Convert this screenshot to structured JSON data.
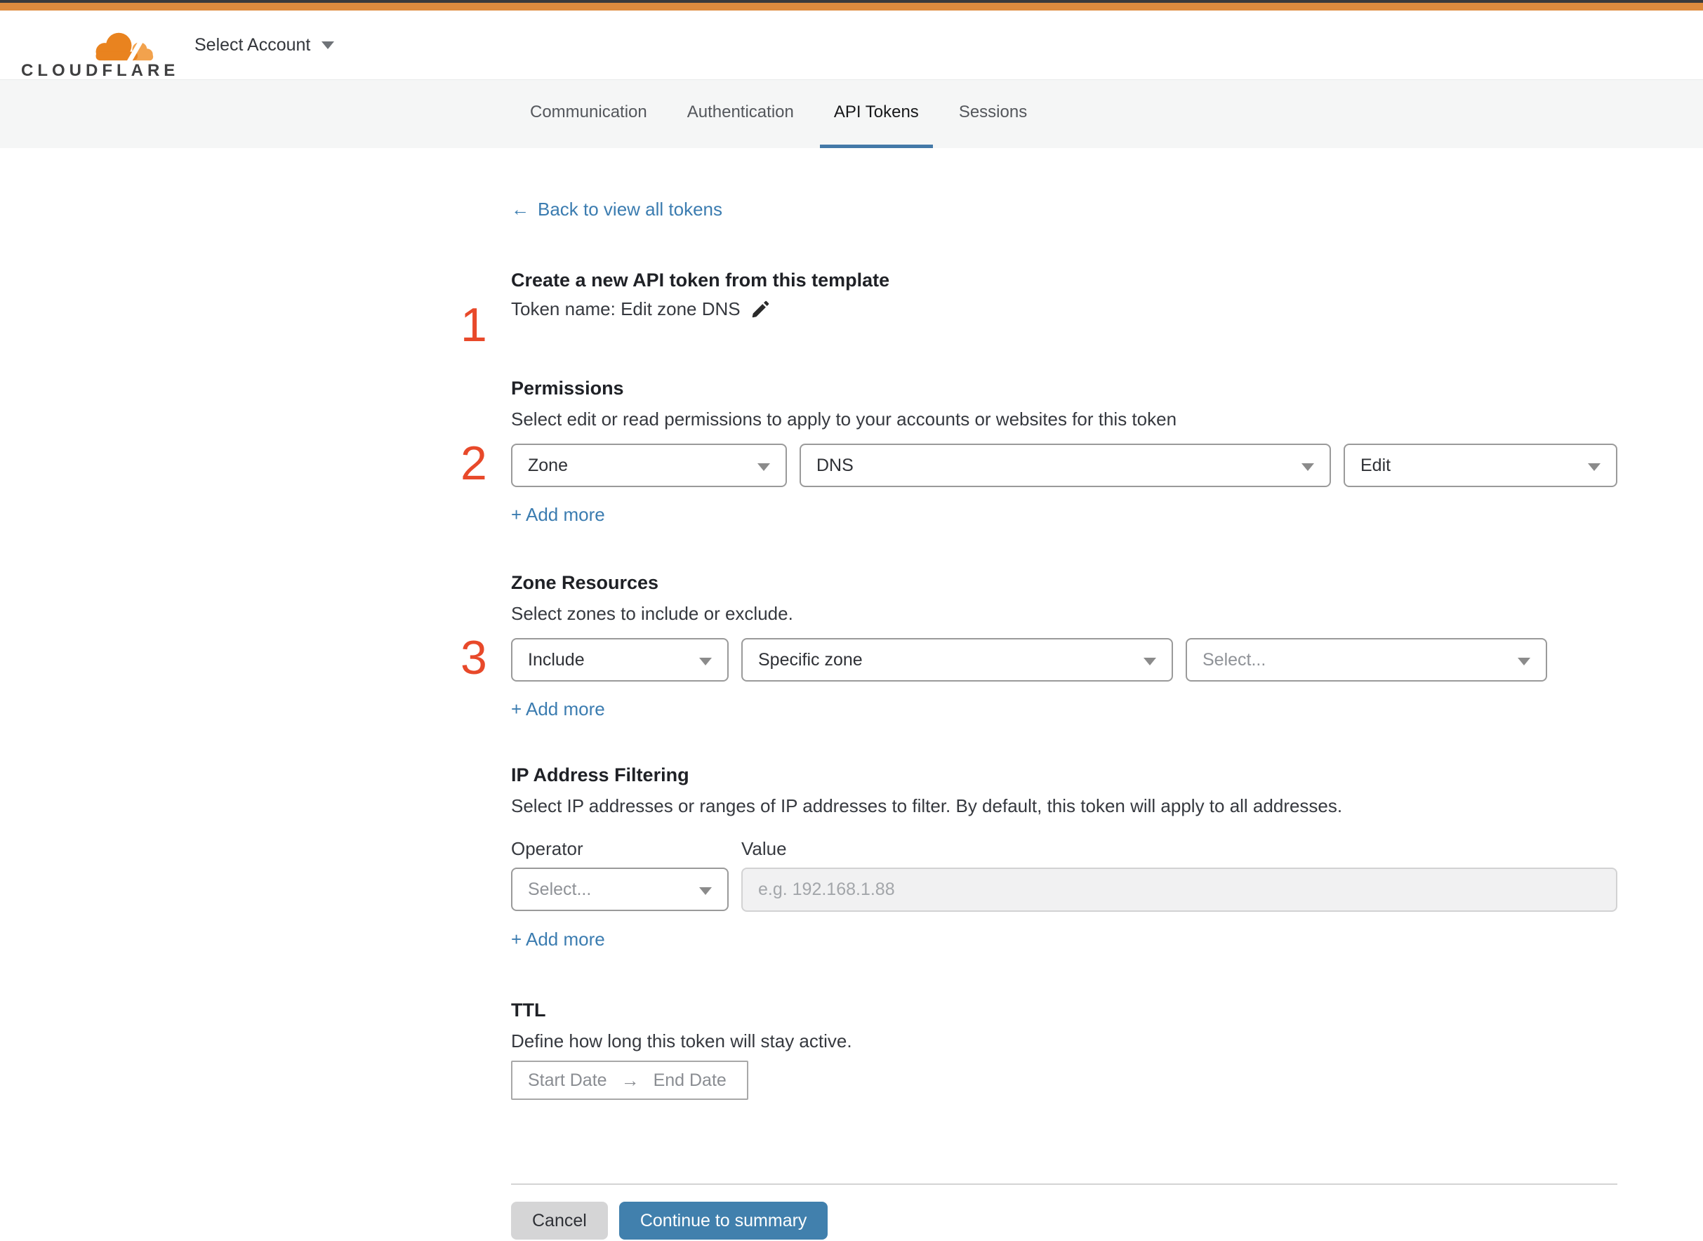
{
  "header": {
    "logo_text": "CLOUDFLARE",
    "account_selector": "Select Account"
  },
  "tabs": {
    "items": [
      {
        "label": "Communication"
      },
      {
        "label": "Authentication"
      },
      {
        "label": "API Tokens"
      },
      {
        "label": "Sessions"
      }
    ]
  },
  "back_link": {
    "arrow": "←",
    "label": "Back to view all tokens"
  },
  "create_token": {
    "step": "1",
    "heading": "Create a new API token from this template",
    "token_name": "Token name: Edit zone DNS"
  },
  "permissions": {
    "step": "2",
    "title": "Permissions",
    "subtitle": "Select edit or read permissions to apply to your accounts or websites for this token",
    "scope": "Zone",
    "group": "DNS",
    "access": "Edit",
    "add_more": "+ Add more"
  },
  "zone_resources": {
    "step": "3",
    "title": "Zone Resources",
    "subtitle": "Select zones to include or exclude.",
    "operator": "Include",
    "type": "Specific zone",
    "zone_placeholder": "Select...",
    "add_more": "+ Add more"
  },
  "ip_filtering": {
    "title": "IP Address Filtering",
    "subtitle": "Select IP addresses or ranges of IP addresses to filter. By default, this token will apply to all addresses.",
    "operator_label": "Operator",
    "value_label": "Value",
    "operator_placeholder": "Select...",
    "value_placeholder": "e.g. 192.168.1.88",
    "add_more": "+ Add more"
  },
  "ttl": {
    "title": "TTL",
    "subtitle": "Define how long this token will stay active.",
    "start": "Start Date",
    "arrow": "→",
    "end": "End Date"
  },
  "footer": {
    "cancel": "Cancel",
    "continue": "Continue to summary"
  },
  "colors": {
    "topbar_dark": "#3a3a3c",
    "accent_orange": "#de8b3e",
    "link_blue": "#3b7cb0",
    "button_blue": "#4180ad",
    "step_red": "#e8492a",
    "active_tab_underline": "#4479a8"
  }
}
